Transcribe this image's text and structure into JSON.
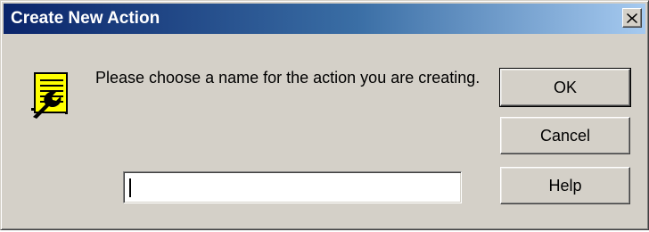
{
  "window": {
    "title": "Create New Action",
    "close_icon": "close-icon"
  },
  "content": {
    "icon": "action-wrench-icon",
    "message": "Please choose a name for the action you are creating."
  },
  "input": {
    "value": "",
    "placeholder": ""
  },
  "buttons": {
    "ok_label": "OK",
    "cancel_label": "Cancel",
    "help_label": "Help"
  },
  "colors": {
    "dialog_face": "#d4d0c8",
    "titlebar_start": "#0a246a",
    "titlebar_end": "#a6caf0",
    "icon_yellow": "#ffff00"
  }
}
